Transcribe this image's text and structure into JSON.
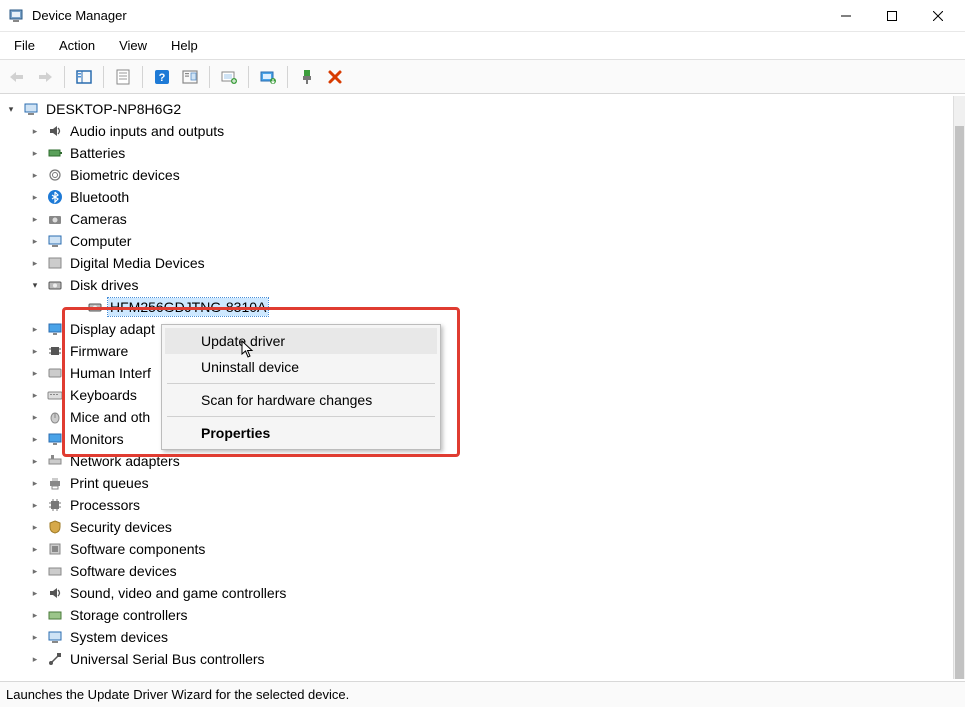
{
  "window": {
    "title": "Device Manager"
  },
  "menubar": {
    "file": "File",
    "action": "Action",
    "view": "View",
    "help": "Help"
  },
  "tree": {
    "root": "DESKTOP-NP8H6G2",
    "cat_audio": "Audio inputs and outputs",
    "cat_batteries": "Batteries",
    "cat_biometric": "Biometric devices",
    "cat_bluetooth": "Bluetooth",
    "cat_cameras": "Cameras",
    "cat_computer": "Computer",
    "cat_digitalmedia": "Digital Media Devices",
    "cat_disk": "Disk drives",
    "disk_child": "HFM256GDJTNG-8310A",
    "cat_display": "Display adapt",
    "cat_firmware": "Firmware",
    "cat_hid": "Human Interf",
    "cat_keyboards": "Keyboards",
    "cat_mice": "Mice and oth",
    "cat_monitors": "Monitors",
    "cat_network": "Network adapters",
    "cat_print": "Print queues",
    "cat_processors": "Processors",
    "cat_security": "Security devices",
    "cat_softcomp": "Software components",
    "cat_softdev": "Software devices",
    "cat_sound": "Sound, video and game controllers",
    "cat_storage": "Storage controllers",
    "cat_system": "System devices",
    "cat_usb": "Universal Serial Bus controllers"
  },
  "contextMenu": {
    "update": "Update driver",
    "uninstall": "Uninstall device",
    "scan": "Scan for hardware changes",
    "properties": "Properties"
  },
  "status": {
    "text": "Launches the Update Driver Wizard for the selected device."
  }
}
